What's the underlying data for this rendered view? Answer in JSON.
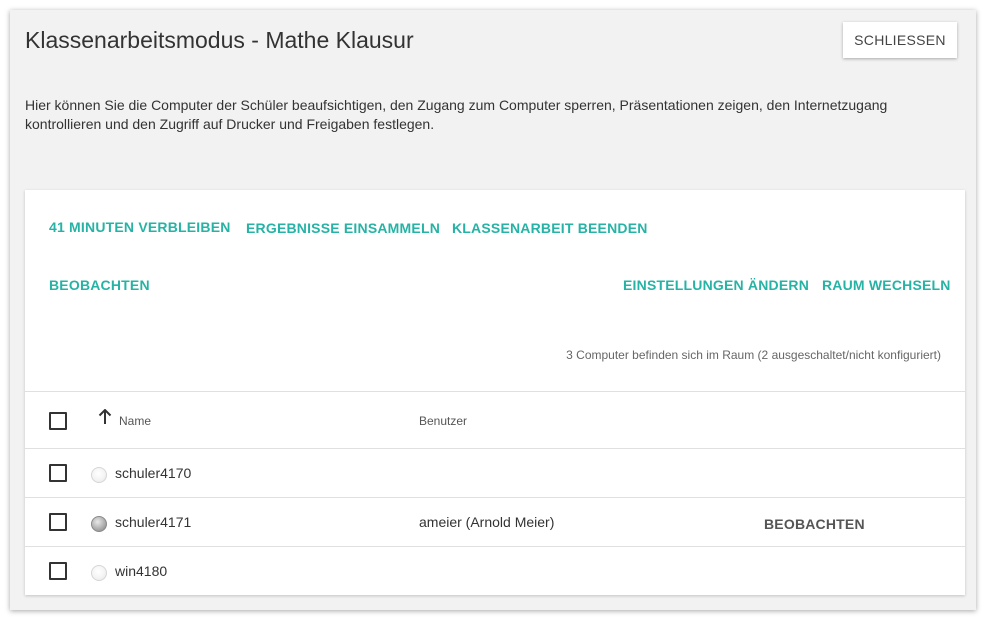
{
  "dialog": {
    "title": "Klassenarbeitsmodus - Mathe Klausur",
    "close_label": "SCHLIESSEN",
    "description": "Hier können Sie die Computer der Schüler beaufsichtigen, den Zugang zum Computer sperren, Präsentationen zeigen, den Internetzugang kontrollieren und den Zugriff auf Drucker und Freigaben festlegen."
  },
  "actions": {
    "remaining": "41 MINUTEN VERBLEIBEN",
    "collect": "ERGEBNISSE EINSAMMELN",
    "finish": "KLASSENARBEIT BEENDEN",
    "observe": "BEOBACHTEN",
    "settings": "EINSTELLUNGEN ÄNDERN",
    "change_room": "RAUM WECHSELN"
  },
  "summary": "3 Computer befinden sich im Raum (2 ausgeschaltet/nicht konfiguriert)",
  "table": {
    "columns": {
      "name": "Name",
      "user": "Benutzer"
    },
    "sort_icon": "arrow-up-icon",
    "rows": [
      {
        "name": "schuler4170",
        "user": "",
        "status": "off",
        "action": ""
      },
      {
        "name": "schuler4171",
        "user": "ameier (Arnold Meier)",
        "status": "on",
        "action": "BEOBACHTEN"
      },
      {
        "name": "win4180",
        "user": "",
        "status": "off",
        "action": ""
      }
    ]
  },
  "colors": {
    "accent": "#26b3a5",
    "background": "#f2f2f2"
  }
}
